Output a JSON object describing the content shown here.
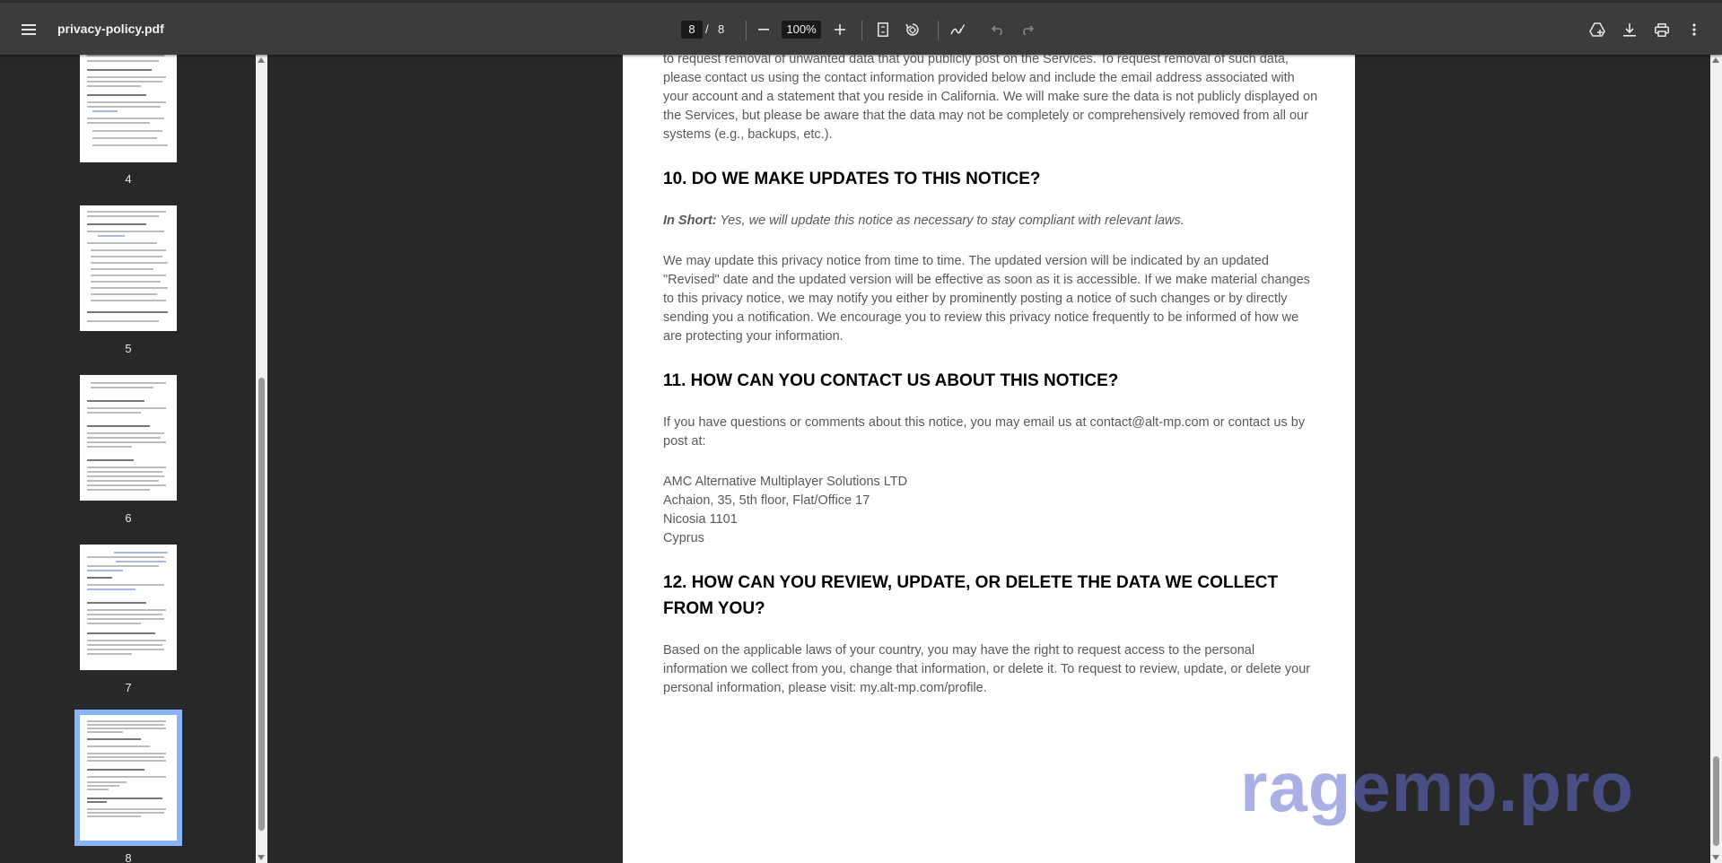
{
  "toolbar": {
    "title": "privacy-policy.pdf",
    "page_current": "8",
    "page_sep": "/",
    "page_total": "8",
    "zoom": "100%",
    "icons": [
      "menu-icon",
      "zoom-out-icon",
      "zoom-in-icon",
      "fit-page-icon",
      "rotate-icon",
      "annotate-icon",
      "undo-icon",
      "redo-icon",
      "drive-icon",
      "download-icon",
      "print-icon",
      "more-icon"
    ]
  },
  "sidebar": {
    "thumbnails": [
      {
        "label": "4"
      },
      {
        "label": "5"
      },
      {
        "label": "6"
      },
      {
        "label": "7"
      },
      {
        "label": "8",
        "active": true
      }
    ]
  },
  "document": {
    "intro": "to request removal of unwanted data that you publicly post on the Services. To request removal of such data, please contact us using the contact information provided below and include the email address associated with your account and a statement that you reside in California. We will make sure the data is not publicly displayed on the Services, but please be aware that the data may not be completely or comprehensively removed from all our systems (e.g., backups, etc.).",
    "s10_title": "10. DO WE MAKE UPDATES TO THIS NOTICE?",
    "s10_short_label": "In Short:",
    "s10_short_text": " Yes, we will update this notice as necessary to stay compliant with relevant laws.",
    "s10_body": "We may update this privacy notice from time to time. The updated version will be indicated by an updated \"Revised\" date and the updated version will be effective as soon as it is accessible. If we make material changes to this privacy notice, we may notify you either by prominently posting a notice of such changes or by directly sending you a notification. We encourage you to review this privacy notice frequently to be informed of how we are protecting your information.",
    "s11_title": "11. HOW CAN YOU CONTACT US ABOUT THIS NOTICE?",
    "s11_body": "If you have questions or comments about this notice, you may email us at contact@alt-mp.com or contact us by post at:",
    "address": [
      "AMC Alternative Multiplayer Solutions LTD",
      "Achaion, 35, 5th floor, Flat/Office 17",
      "Nicosia 1101",
      "Cyprus"
    ],
    "s12_title": "12. HOW CAN YOU REVIEW, UPDATE, OR DELETE THE DATA WE COLLECT FROM YOU?",
    "s12_body": "Based on the applicable laws of your country, you may have the right to request access to the personal information we collect from you, change that information, or delete it. To request to review, update, or delete your personal information, please visit: my.alt-mp.com/profile."
  },
  "watermark": "ragemp.pro"
}
